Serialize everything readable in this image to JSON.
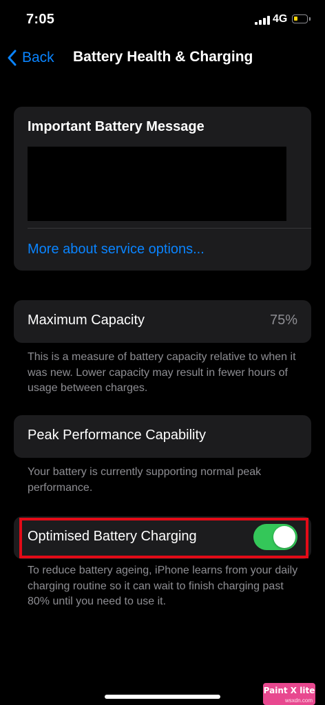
{
  "status_bar": {
    "time": "7:05",
    "network": "4G",
    "battery_level_percent": 30,
    "battery_color": "#ffd60a"
  },
  "nav": {
    "back_label": "Back",
    "title": "Battery Health & Charging",
    "back_icon": "chevron-left-icon"
  },
  "battery_message": {
    "title": "Important Battery Message",
    "link": "More about service options..."
  },
  "maximum_capacity": {
    "label": "Maximum Capacity",
    "value": "75%",
    "footnote": "This is a measure of battery capacity relative to when it was new. Lower capacity may result in fewer hours of usage between charges."
  },
  "peak_performance": {
    "label": "Peak Performance Capability",
    "footnote": "Your battery is currently supporting normal peak performance."
  },
  "optimised_charging": {
    "label": "Optimised Battery Charging",
    "enabled": true,
    "toggle_color": "#34c759",
    "footnote": "To reduce battery ageing, iPhone learns from your daily charging routine so it can wait to finish charging past 80% until you need to use it."
  },
  "annotation": {
    "highlight_color": "#e30b17"
  },
  "watermark": {
    "text": "Paint X lite",
    "subtext": "wsxdn.com"
  },
  "colors": {
    "accent": "#0a84ff",
    "background": "#000000",
    "card": "#1c1c1e",
    "secondary_text": "#8e8e93"
  }
}
